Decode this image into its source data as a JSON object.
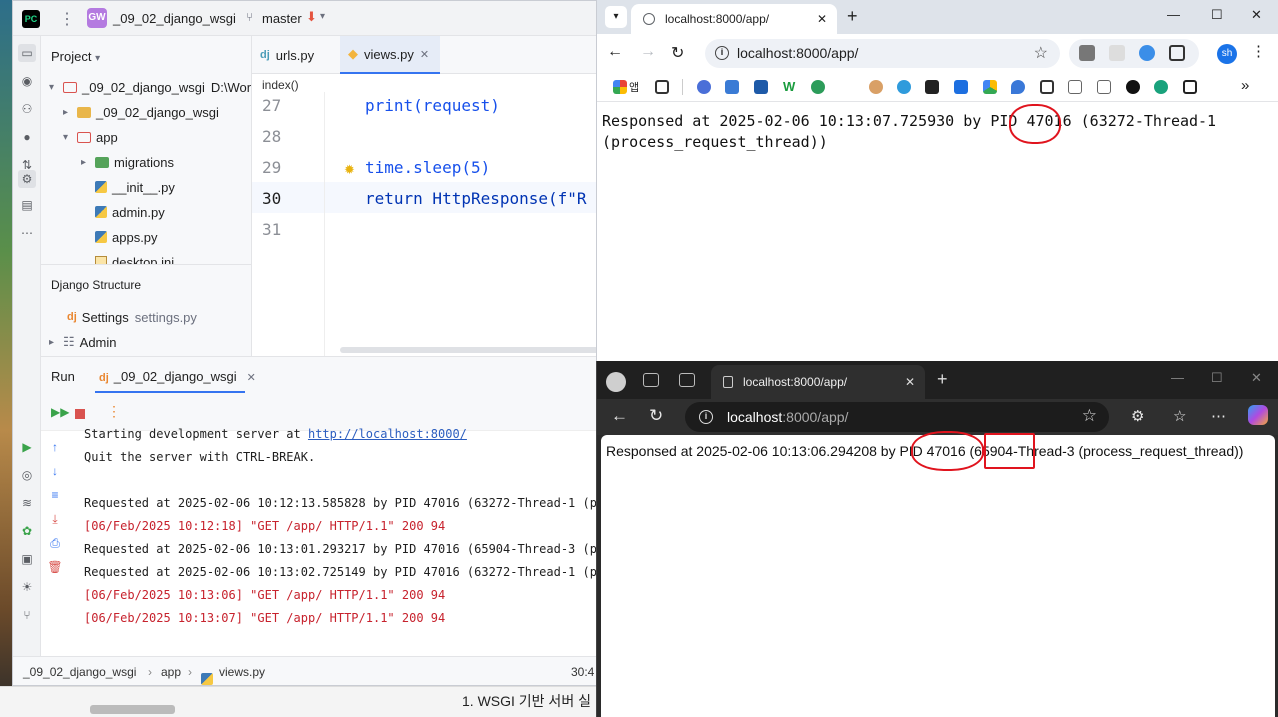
{
  "ide": {
    "project_name": "_09_02_django_wsgi",
    "project_badge": "GW",
    "branch": "master",
    "project_panel_title": "Project",
    "tree": [
      {
        "label": "_09_02_django_wsgi",
        "extra": "D:\\Worl",
        "kind": "folder-red",
        "arrow": "▾"
      },
      {
        "label": "_09_02_django_wsgi",
        "extra": "",
        "kind": "folder",
        "arrow": "▸"
      },
      {
        "label": "app",
        "extra": "",
        "kind": "folder-red",
        "arrow": "▾"
      },
      {
        "label": "migrations",
        "extra": "",
        "kind": "folder-green",
        "arrow": "▸"
      },
      {
        "label": "__init__.py",
        "extra": "",
        "kind": "py",
        "arrow": ""
      },
      {
        "label": "admin.py",
        "extra": "",
        "kind": "py",
        "arrow": ""
      },
      {
        "label": "apps.py",
        "extra": "",
        "kind": "py",
        "arrow": ""
      },
      {
        "label": "desktop.ini",
        "extra": "",
        "kind": "ini",
        "arrow": ""
      }
    ],
    "django_panel_title": "Django Structure",
    "django_items": [
      {
        "label": "Settings",
        "extra": "settings.py"
      },
      {
        "label": "Admin",
        "extra": ""
      }
    ],
    "tabs": [
      {
        "label": "urls.py",
        "active": false
      },
      {
        "label": "views.py",
        "active": true
      }
    ],
    "breadcrumb": "index()",
    "code_lines": [
      {
        "num": "27",
        "code": "print(request)"
      },
      {
        "num": "28",
        "code": ""
      },
      {
        "num": "29",
        "code": "time.sleep(5)"
      },
      {
        "num": "30",
        "code": "return HttpResponse(f\"R"
      },
      {
        "num": "31",
        "code": ""
      }
    ],
    "run_label": "Run",
    "run_tab": "_09_02_django_wsgi",
    "console": [
      {
        "text": "Starting development server at ",
        "link": "http://localhost:8000/",
        "style": "normal"
      },
      {
        "text": "Quit the server with CTRL-BREAK.",
        "link": "",
        "style": "normal"
      },
      {
        "text": "",
        "link": "",
        "style": "normal"
      },
      {
        "text": "Requested at 2025-02-06 10:12:13.585828 by PID 47016 (63272-Thread-1 (pr",
        "link": "",
        "style": "normal"
      },
      {
        "text": "[06/Feb/2025 10:12:18] \"GET /app/ HTTP/1.1\" 200 94",
        "link": "",
        "style": "red"
      },
      {
        "text": "Requested at 2025-02-06 10:13:01.293217 by PID 47016 (65904-Thread-3 (pr",
        "link": "",
        "style": "normal"
      },
      {
        "text": "Requested at 2025-02-06 10:13:02.725149 by PID 47016 (63272-Thread-1 (pr",
        "link": "",
        "style": "normal"
      },
      {
        "text": "[06/Feb/2025 10:13:06] \"GET /app/ HTTP/1.1\" 200 94",
        "link": "",
        "style": "red"
      },
      {
        "text": "[06/Feb/2025 10:13:07] \"GET /app/ HTTP/1.1\" 200 94",
        "link": "",
        "style": "red"
      }
    ],
    "status": {
      "crumb1": "_09_02_django_wsgi",
      "crumb2": "app",
      "crumb3": "views.py",
      "position": "30:4"
    }
  },
  "chrome": {
    "tab_title": "localhost:8000/app/",
    "url": "localhost:8000/app/",
    "avatar": "sh",
    "bookmark_label": "앱",
    "content": "Responsed at 2025-02-06 10:13:07.725930 by PID 47016 (63272-Thread-1\n(process_request_thread))"
  },
  "edge": {
    "tab_title": "localhost:8000/app/",
    "url_host": "localhost",
    "url_path": ":8000/app/",
    "content": "Responsed at 2025-02-06 10:13:06.294208 by PID 47016 (65904-Thread-3 (process_request_thread))"
  },
  "background_doc": {
    "text": "1.  WSGI 기반 서버 실"
  }
}
